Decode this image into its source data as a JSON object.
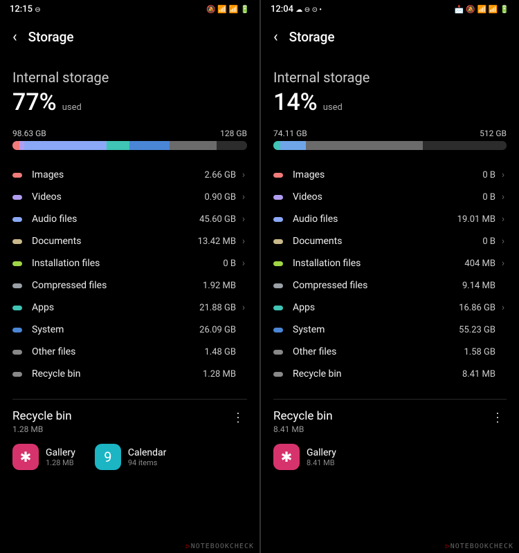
{
  "watermark": "NOTEBOOKCHECK",
  "phones": [
    {
      "time": "12:15",
      "time_icon": "⊖",
      "status_icons": "🔕 📶 📶 🔋",
      "title": "Storage",
      "section": "Internal storage",
      "percent": "77%",
      "used_label": "used",
      "used_gb": "98.63 GB",
      "total_gb": "128 GB",
      "bar": [
        {
          "color": "#f07b7b",
          "w": "3"
        },
        {
          "color": "#b19df0",
          "w": "2"
        },
        {
          "color": "#8aa8f5",
          "w": "35"
        },
        {
          "color": "#3fc4b5",
          "w": "10"
        },
        {
          "color": "#4a86d6",
          "w": "17"
        },
        {
          "color": "#6b6b6b",
          "w": "20"
        },
        {
          "color": "#2c2c2c",
          "w": "13"
        }
      ],
      "categories": [
        {
          "color": "#f07b7b",
          "name": "Images",
          "size": "2.66 GB",
          "nav": true
        },
        {
          "color": "#b19df0",
          "name": "Videos",
          "size": "0.90 GB",
          "nav": true
        },
        {
          "color": "#8aa8f5",
          "name": "Audio files",
          "size": "45.60 GB",
          "nav": true
        },
        {
          "color": "#c9b98a",
          "name": "Documents",
          "size": "13.42 MB",
          "nav": true
        },
        {
          "color": "#9fd646",
          "name": "Installation files",
          "size": "0 B",
          "nav": true
        },
        {
          "color": "#9aa0a6",
          "name": "Compressed files",
          "size": "1.92 MB",
          "nav": false
        },
        {
          "color": "#3fc4b5",
          "name": "Apps",
          "size": "21.88 GB",
          "nav": true
        },
        {
          "color": "#4a86d6",
          "name": "System",
          "size": "26.09 GB",
          "nav": false
        },
        {
          "color": "#888",
          "name": "Other files",
          "size": "1.48 GB",
          "nav": false
        },
        {
          "color": "#888",
          "name": "Recycle bin",
          "size": "1.28 MB",
          "nav": false
        }
      ],
      "rb_title": "Recycle bin",
      "rb_size": "1.28 MB",
      "apps": [
        {
          "name": "Gallery",
          "sub": "1.28 MB",
          "bg": "#d6336c",
          "glyph": "✱"
        },
        {
          "name": "Calendar",
          "sub": "94 items",
          "bg": "#1bb5c4",
          "glyph": "9"
        }
      ]
    },
    {
      "time": "12:04",
      "time_icon": "☁ ⊖ ⊙ •",
      "status_icons": "📩 🔕 📶 📶 🔋",
      "title": "Storage",
      "section": "Internal storage",
      "percent": "14%",
      "used_label": "used",
      "used_gb": "74.11 GB",
      "total_gb": "512 GB",
      "bar": [
        {
          "color": "#3fc4b5",
          "w": "3"
        },
        {
          "color": "#6fa6e8",
          "w": "11"
        },
        {
          "color": "#6b6b6b",
          "w": "50"
        },
        {
          "color": "#2c2c2c",
          "w": "36"
        }
      ],
      "categories": [
        {
          "color": "#f07b7b",
          "name": "Images",
          "size": "0 B",
          "nav": true
        },
        {
          "color": "#b19df0",
          "name": "Videos",
          "size": "0 B",
          "nav": true
        },
        {
          "color": "#8aa8f5",
          "name": "Audio files",
          "size": "19.01 MB",
          "nav": true
        },
        {
          "color": "#c9b98a",
          "name": "Documents",
          "size": "0 B",
          "nav": true
        },
        {
          "color": "#9fd646",
          "name": "Installation files",
          "size": "404 MB",
          "nav": true
        },
        {
          "color": "#9aa0a6",
          "name": "Compressed files",
          "size": "9.14 MB",
          "nav": false
        },
        {
          "color": "#3fc4b5",
          "name": "Apps",
          "size": "16.86 GB",
          "nav": true
        },
        {
          "color": "#4a86d6",
          "name": "System",
          "size": "55.23 GB",
          "nav": false
        },
        {
          "color": "#888",
          "name": "Other files",
          "size": "1.58 GB",
          "nav": false
        },
        {
          "color": "#888",
          "name": "Recycle bin",
          "size": "8.41 MB",
          "nav": false
        }
      ],
      "rb_title": "Recycle bin",
      "rb_size": "8.41 MB",
      "apps": [
        {
          "name": "Gallery",
          "sub": "8.41 MB",
          "bg": "#d6336c",
          "glyph": "✱"
        }
      ]
    }
  ]
}
